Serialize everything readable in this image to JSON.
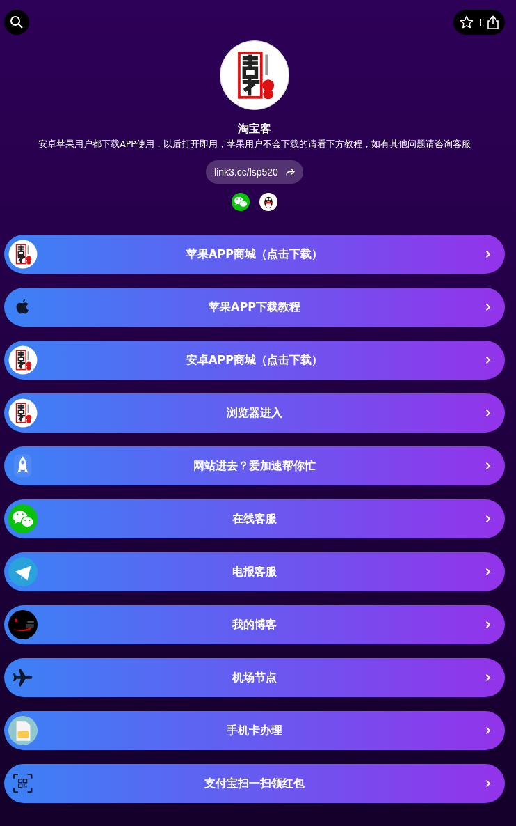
{
  "profile": {
    "name": "淘宝客",
    "bio": "安卓苹果用户都下载APP使用，以后打开即用，苹果用户不会下载的请看下方教程，如有其他问题请咨询客服",
    "link": "link3.cc/lsp520"
  },
  "socials": [
    {
      "kind": "wechat"
    },
    {
      "kind": "qq"
    }
  ],
  "links": [
    {
      "label": "苹果APP商城（点击下载）",
      "kind": "logo"
    },
    {
      "label": "苹果APP下载教程",
      "kind": "apple"
    },
    {
      "label": "安卓APP商城（点击下载）",
      "kind": "logo"
    },
    {
      "label": "浏览器进入",
      "kind": "logo"
    },
    {
      "label": "网站进去？爱加速帮你忙",
      "kind": "rocket"
    },
    {
      "label": "在线客服",
      "kind": "wechat"
    },
    {
      "label": "电报客服",
      "kind": "telegram"
    },
    {
      "label": "我的博客",
      "kind": "blog"
    },
    {
      "label": "机场节点",
      "kind": "plane"
    },
    {
      "label": "手机卡办理",
      "kind": "sim"
    },
    {
      "label": "支付宝扫一扫领红包",
      "kind": "qr"
    }
  ]
}
